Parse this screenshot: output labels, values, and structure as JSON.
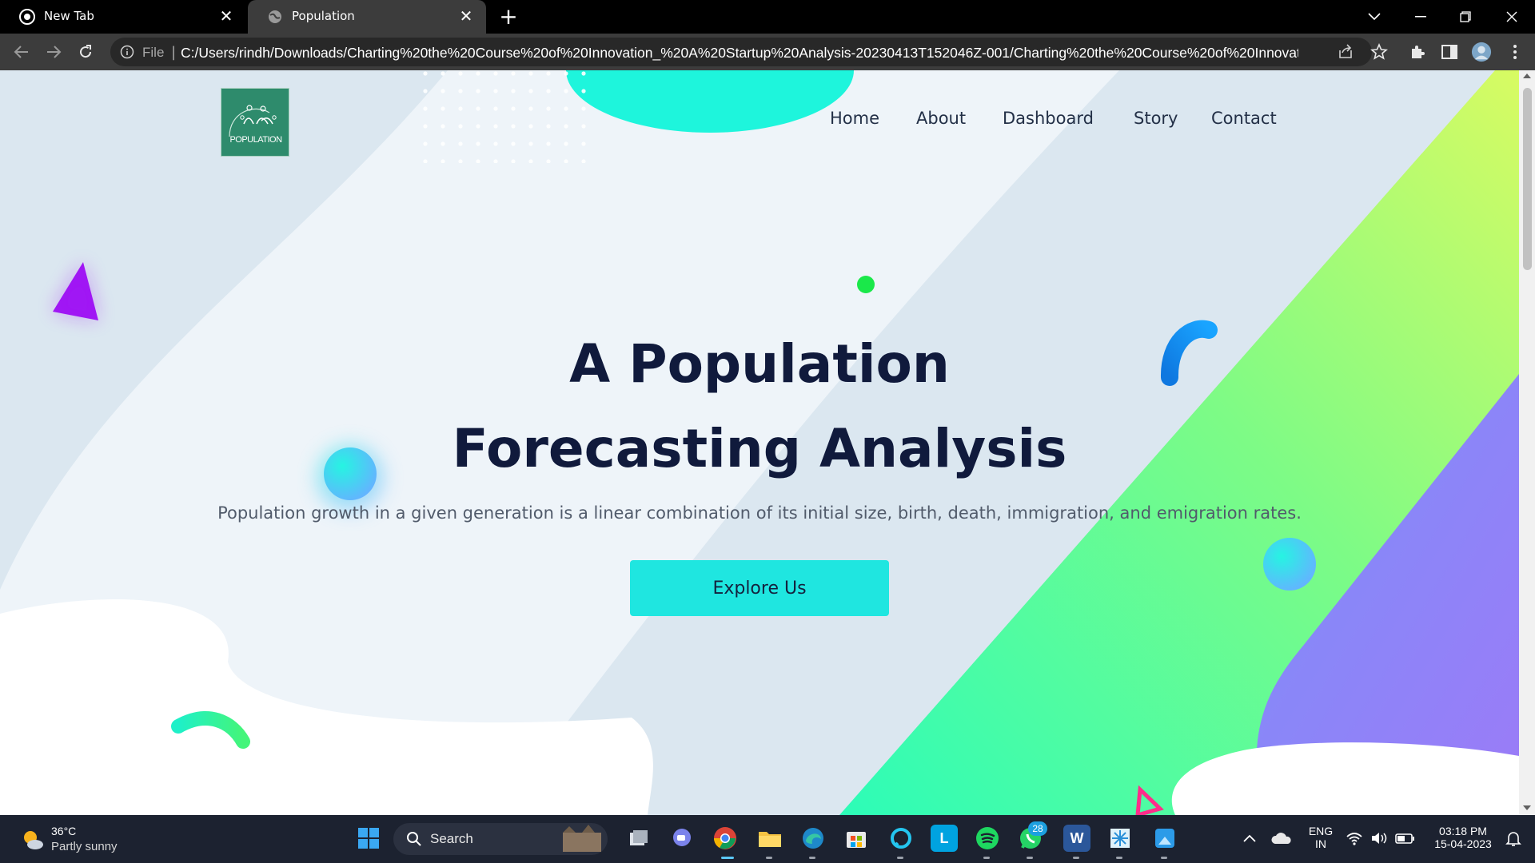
{
  "browser": {
    "tabs": [
      {
        "title": "New Tab",
        "active": false
      },
      {
        "title": "Population",
        "active": true
      }
    ],
    "address": {
      "scheme_label": "File",
      "url": "C:/Users/rindh/Downloads/Charting%20the%20Course%20of%20Innovation_%20A%20Startup%20Analysis-20230413T152046Z-001/Charting%20the%20Course%20of%20Innovation_%..."
    }
  },
  "site": {
    "logo_text": "POPULATION",
    "nav": [
      "Home",
      "About",
      "Dashboard",
      "Story",
      "Contact"
    ],
    "hero": {
      "title_line1": "A Population",
      "title_line2": "Forecasting Analysis",
      "subtitle": "Population growth in a given generation is a linear combination of its initial size, birth, death, immigration, and emigration rates.",
      "cta": "Explore Us"
    }
  },
  "taskbar": {
    "weather": {
      "temp": "36°C",
      "condition": "Partly sunny"
    },
    "search_label": "Search",
    "whatsapp_badge": "28",
    "lang_line1": "ENG",
    "lang_line2": "IN",
    "time": "03:18 PM",
    "date": "15-04-2023"
  },
  "colors": {
    "hero_title": "#101a3c",
    "cta_bg": "#1fe6e0",
    "green_gradient_start": "#c8ff5a",
    "green_gradient_end": "#2dfbb0",
    "purple_blob": "#8a7cf8"
  }
}
